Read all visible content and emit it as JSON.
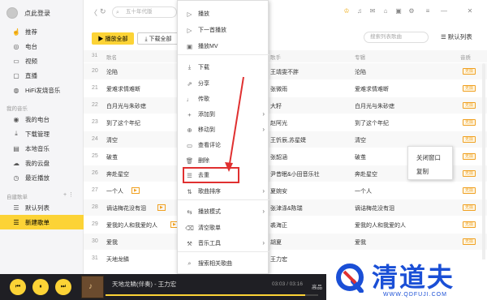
{
  "sidebar": {
    "login_label": "点此登录",
    "online_items": [
      {
        "icon": "thumb-up-icon",
        "label": "推荐"
      },
      {
        "icon": "radio-icon",
        "label": "电台"
      },
      {
        "icon": "video-icon",
        "label": "视频"
      },
      {
        "icon": "live-icon",
        "label": "直播"
      },
      {
        "icon": "hifi-icon",
        "label": "HiFi发烧音乐"
      }
    ],
    "my_music_label": "我的音乐",
    "my_items": [
      {
        "icon": "my-radio-icon",
        "label": "我的电台"
      },
      {
        "icon": "download-icon",
        "label": "下载管理"
      },
      {
        "icon": "local-music-icon",
        "label": "本地音乐"
      },
      {
        "icon": "cloud-icon",
        "label": "我的云盘"
      },
      {
        "icon": "recent-icon",
        "label": "最近播放"
      }
    ],
    "created_label": "自建歌单",
    "created_right": "+ ⋮",
    "playlist_items": [
      {
        "icon": "list-icon",
        "label": "默认列表"
      },
      {
        "icon": "new-list-icon",
        "label": "新建歌单"
      }
    ]
  },
  "topbar": {
    "back": "〈",
    "refresh": "↻",
    "search_placeholder": "五十年代版",
    "icons": [
      "skin-icon",
      "headphone-icon",
      "mail-icon",
      "gift-icon",
      "mini-icon",
      "settings-icon",
      "menu-icon",
      "minimize-icon",
      "close-icon"
    ],
    "icon_glyphs": [
      "♔",
      "♫",
      "✉",
      "⌂",
      "▣",
      "⚙",
      "≡",
      "—",
      "✕"
    ]
  },
  "toolbar": {
    "play_all": "▶ 播放全部",
    "download_all": "⤓ 下载全部",
    "search_placeholder": "搜索列表歌曲",
    "batch": "☰ 默认列表"
  },
  "table": {
    "headers": {
      "num": "31",
      "song": "歌名",
      "artist": "歌手",
      "album": "专辑",
      "quality": "音质"
    },
    "rows": [
      {
        "num": "20",
        "title": "沦陷",
        "mv": false,
        "artist": "王靖雯不胖",
        "album": "沦陷",
        "badge": "无损"
      },
      {
        "num": "21",
        "title": "爱难求情难断",
        "mv": false,
        "artist": "张微雨",
        "album": "爱难求情难断",
        "badge": "无损"
      },
      {
        "num": "22",
        "title": "白月光与朱砂痣",
        "mv": false,
        "artist": "大籽",
        "album": "白月光与朱砂痣",
        "badge": "无损"
      },
      {
        "num": "23",
        "title": "到了这个年纪",
        "mv": false,
        "artist": "赵阿光",
        "album": "到了这个年纪",
        "badge": "无损"
      },
      {
        "num": "24",
        "title": "清空",
        "mv": false,
        "artist": "王忻辰,苏星婕",
        "album": "清空",
        "badge": "无损"
      },
      {
        "num": "25",
        "title": "破茧",
        "mv": false,
        "artist": "张韶涵",
        "album": "破茧",
        "badge": "无损"
      },
      {
        "num": "26",
        "title": "奔赴星空",
        "mv": false,
        "artist": "尹昔眠&小田音乐社",
        "album": "奔赴星空",
        "badge": "无损"
      },
      {
        "num": "27",
        "title": "一个人",
        "mv": true,
        "artist": "夏婉安",
        "album": "一个人",
        "badge": "无损"
      },
      {
        "num": "28",
        "title": "谪诘梅花没有泪",
        "mv": true,
        "artist": "张津涤&陈瑞",
        "album": "谪诘梅花没有泪",
        "badge": "无损"
      },
      {
        "num": "29",
        "title": "爱我的人和我爱的人",
        "mv": true,
        "artist": "裘海正",
        "album": "爱我的人和我爱的人",
        "badge": "无损"
      },
      {
        "num": "30",
        "title": "爱我",
        "mv": false,
        "artist": "胡夏",
        "album": "爱我",
        "badge": "无损"
      },
      {
        "num": "31",
        "title": "天地龙鳞",
        "mv": false,
        "artist": "王力宏",
        "album": "",
        "badge": ""
      }
    ]
  },
  "context_menu": [
    {
      "icon": "play-icon",
      "glyph": "▷",
      "label": "播放",
      "sub": false
    },
    {
      "icon": "next-play-icon",
      "glyph": "▷",
      "label": "下一首播放",
      "sub": false
    },
    {
      "icon": "mv-icon",
      "glyph": "▣",
      "label": "播放MV",
      "sub": false
    },
    {
      "icon": "download-icon",
      "glyph": "⤓",
      "label": "下载",
      "sub": false
    },
    {
      "icon": "share-icon",
      "glyph": "⇗",
      "label": "分享",
      "sub": false
    },
    {
      "icon": "lyrics-icon",
      "glyph": "♩",
      "label": "传歌",
      "sub": false
    },
    {
      "icon": "add-icon",
      "glyph": "+",
      "label": "添加到",
      "sub": true
    },
    {
      "icon": "move-icon",
      "glyph": "⊕",
      "label": "移动到",
      "sub": true
    },
    {
      "icon": "comment-icon",
      "glyph": "▭",
      "label": "查看评论",
      "sub": false
    },
    {
      "icon": "delete-icon",
      "glyph": "🗑",
      "label": "删除",
      "sub": false
    },
    {
      "icon": "dedupe-icon",
      "glyph": "☰",
      "label": "去重",
      "sub": false
    },
    {
      "icon": "sort-icon",
      "glyph": "⇅",
      "label": "歌曲排序",
      "sub": true
    },
    {
      "icon": "play-mode-icon",
      "glyph": "⇆",
      "label": "播放模式",
      "sub": true
    },
    {
      "icon": "clear-icon",
      "glyph": "⌫",
      "label": "清空歌单",
      "sub": false
    },
    {
      "icon": "tools-icon",
      "glyph": "⚒",
      "label": "音乐工具",
      "sub": true
    },
    {
      "icon": "search-icon",
      "glyph": "⌕",
      "label": "搜索相关歌曲",
      "sub": false
    }
  ],
  "popup": {
    "close_window": "关闭窗口",
    "copy": "复制"
  },
  "player": {
    "prev": "⏮",
    "pause": "⏸",
    "next": "⏭",
    "title": "天地龙鳞(伴奏) - 王力宏",
    "time": "03:03 / 03:16",
    "quality": "高品",
    "progress": 0.94
  },
  "watermark": {
    "text": "清道夫",
    "url": "WWW.QDFUJI.COM"
  }
}
